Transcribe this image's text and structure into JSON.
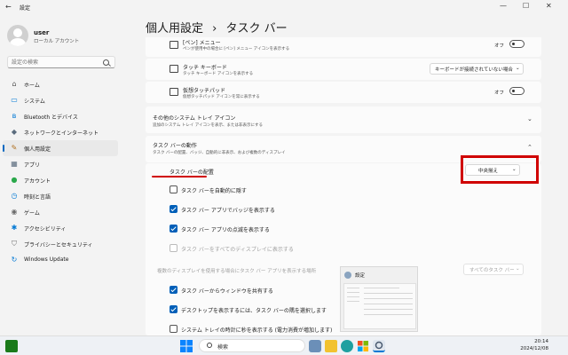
{
  "window": {
    "title": "設定",
    "back": "←",
    "minimize": "—",
    "maximize": "☐",
    "close": "✕"
  },
  "user": {
    "name": "user",
    "account": "ローカル アカウント"
  },
  "search": {
    "placeholder": "設定の検索"
  },
  "nav": [
    {
      "label": "ホーム",
      "icon": "home-icon",
      "glyph": "⌂",
      "color": "#555555"
    },
    {
      "label": "システム",
      "icon": "monitor-icon",
      "glyph": "▭",
      "color": "#0078d4"
    },
    {
      "label": "Bluetooth とデバイス",
      "icon": "bluetooth-icon",
      "glyph": "ʙ",
      "color": "#0078d4"
    },
    {
      "label": "ネットワークとインターネット",
      "icon": "network-icon",
      "glyph": "◆",
      "color": "#5a6b7d"
    },
    {
      "label": "個人用設定",
      "icon": "pen-icon",
      "glyph": "✎",
      "color": "#b07020",
      "active": true
    },
    {
      "label": "アプリ",
      "icon": "apps-icon",
      "glyph": "▦",
      "color": "#5a6b7d"
    },
    {
      "label": "アカウント",
      "icon": "account-icon",
      "glyph": "●",
      "color": "#2aa84a"
    },
    {
      "label": "時刻と言語",
      "icon": "clock-icon",
      "glyph": "◷",
      "color": "#0078d4"
    },
    {
      "label": "ゲーム",
      "icon": "game-icon",
      "glyph": "◉",
      "color": "#6b6b6b"
    },
    {
      "label": "アクセシビリティ",
      "icon": "accessibility-icon",
      "glyph": "✱",
      "color": "#0078d4"
    },
    {
      "label": "プライバシーとセキュリティ",
      "icon": "shield-icon",
      "glyph": "⛉",
      "color": "#6b6b6b"
    },
    {
      "label": "Windows Update",
      "icon": "update-icon",
      "glyph": "↻",
      "color": "#0078d4"
    }
  ],
  "breadcrumb": {
    "parent": "個人用設定",
    "sep": "›",
    "current": "タスク バー"
  },
  "pen_menu": {
    "title": "[ペン] メニュー",
    "subtitle": "ペンが使用中の場合に [ペン] メニュー アイコンを表示する",
    "state": "オフ"
  },
  "touch_keyboard": {
    "title": "タッチ キーボード",
    "subtitle": "タッチ キーボード アイコンを表示する",
    "value": "キーボードが接続されていない場合"
  },
  "virtual_touchpad": {
    "title": "仮想タッチパッド",
    "subtitle": "仮想タッチパッド アイコンを常に表示する",
    "state": "オフ"
  },
  "other_tray": {
    "title": "その他のシステム トレイ アイコン",
    "subtitle": "追加のシステム トレイ アイコンを表示、または非表示にする"
  },
  "behaviors": {
    "title": "タスク バーの動作",
    "subtitle": "タスク バーの配置、バッジ、自動的に非表示、および複数のディスプレイ"
  },
  "alignment": {
    "label": "タスク バーの配置",
    "value": "中央揃え"
  },
  "options": [
    {
      "label": "タスク バーを自動的に隠す",
      "checked": false,
      "disabled": false
    },
    {
      "label": "タスク バー アプリでバッジを表示する",
      "checked": true,
      "disabled": false
    },
    {
      "label": "タスク バー アプリの点滅を表示する",
      "checked": true,
      "disabled": false
    },
    {
      "label": "タスク バーをすべてのディスプレイに表示する",
      "checked": false,
      "disabled": true
    }
  ],
  "multi_display": {
    "label": "複数のディスプレイを使用する場合にタスク バー アプリを表示する場所",
    "value": "すべてのタスク バー"
  },
  "options2": [
    {
      "label": "タスク バーからウィンドウを共有する",
      "checked": true,
      "disabled": false
    },
    {
      "label": "デスクトップを表示するには、タスク バーの隅を選択します",
      "checked": true,
      "disabled": false
    },
    {
      "label": "システム トレイの時計に秒を表示する (電力消費が増加します)",
      "checked": false,
      "disabled": false
    }
  ],
  "preview": {
    "title": "設定"
  },
  "taskbar": {
    "search": "検索",
    "time": "20:14",
    "date": "2024/12/08"
  }
}
